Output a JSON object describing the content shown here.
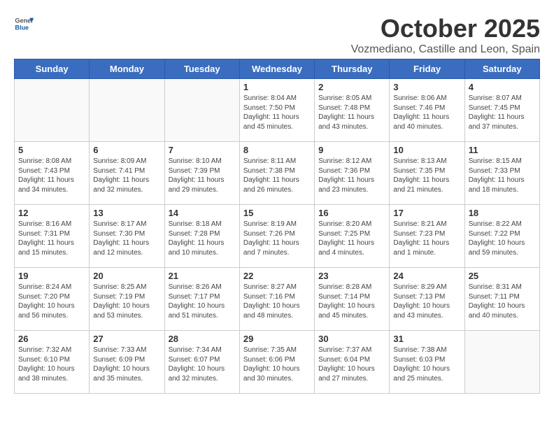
{
  "header": {
    "logo_general": "General",
    "logo_blue": "Blue",
    "month": "October 2025",
    "location": "Vozmediano, Castille and Leon, Spain"
  },
  "weekdays": [
    "Sunday",
    "Monday",
    "Tuesday",
    "Wednesday",
    "Thursday",
    "Friday",
    "Saturday"
  ],
  "weeks": [
    [
      {
        "day": "",
        "info": ""
      },
      {
        "day": "",
        "info": ""
      },
      {
        "day": "",
        "info": ""
      },
      {
        "day": "1",
        "info": "Sunrise: 8:04 AM\nSunset: 7:50 PM\nDaylight: 11 hours\nand 45 minutes."
      },
      {
        "day": "2",
        "info": "Sunrise: 8:05 AM\nSunset: 7:48 PM\nDaylight: 11 hours\nand 43 minutes."
      },
      {
        "day": "3",
        "info": "Sunrise: 8:06 AM\nSunset: 7:46 PM\nDaylight: 11 hours\nand 40 minutes."
      },
      {
        "day": "4",
        "info": "Sunrise: 8:07 AM\nSunset: 7:45 PM\nDaylight: 11 hours\nand 37 minutes."
      }
    ],
    [
      {
        "day": "5",
        "info": "Sunrise: 8:08 AM\nSunset: 7:43 PM\nDaylight: 11 hours\nand 34 minutes."
      },
      {
        "day": "6",
        "info": "Sunrise: 8:09 AM\nSunset: 7:41 PM\nDaylight: 11 hours\nand 32 minutes."
      },
      {
        "day": "7",
        "info": "Sunrise: 8:10 AM\nSunset: 7:39 PM\nDaylight: 11 hours\nand 29 minutes."
      },
      {
        "day": "8",
        "info": "Sunrise: 8:11 AM\nSunset: 7:38 PM\nDaylight: 11 hours\nand 26 minutes."
      },
      {
        "day": "9",
        "info": "Sunrise: 8:12 AM\nSunset: 7:36 PM\nDaylight: 11 hours\nand 23 minutes."
      },
      {
        "day": "10",
        "info": "Sunrise: 8:13 AM\nSunset: 7:35 PM\nDaylight: 11 hours\nand 21 minutes."
      },
      {
        "day": "11",
        "info": "Sunrise: 8:15 AM\nSunset: 7:33 PM\nDaylight: 11 hours\nand 18 minutes."
      }
    ],
    [
      {
        "day": "12",
        "info": "Sunrise: 8:16 AM\nSunset: 7:31 PM\nDaylight: 11 hours\nand 15 minutes."
      },
      {
        "day": "13",
        "info": "Sunrise: 8:17 AM\nSunset: 7:30 PM\nDaylight: 11 hours\nand 12 minutes."
      },
      {
        "day": "14",
        "info": "Sunrise: 8:18 AM\nSunset: 7:28 PM\nDaylight: 11 hours\nand 10 minutes."
      },
      {
        "day": "15",
        "info": "Sunrise: 8:19 AM\nSunset: 7:26 PM\nDaylight: 11 hours\nand 7 minutes."
      },
      {
        "day": "16",
        "info": "Sunrise: 8:20 AM\nSunset: 7:25 PM\nDaylight: 11 hours\nand 4 minutes."
      },
      {
        "day": "17",
        "info": "Sunrise: 8:21 AM\nSunset: 7:23 PM\nDaylight: 11 hours\nand 1 minute."
      },
      {
        "day": "18",
        "info": "Sunrise: 8:22 AM\nSunset: 7:22 PM\nDaylight: 10 hours\nand 59 minutes."
      }
    ],
    [
      {
        "day": "19",
        "info": "Sunrise: 8:24 AM\nSunset: 7:20 PM\nDaylight: 10 hours\nand 56 minutes."
      },
      {
        "day": "20",
        "info": "Sunrise: 8:25 AM\nSunset: 7:19 PM\nDaylight: 10 hours\nand 53 minutes."
      },
      {
        "day": "21",
        "info": "Sunrise: 8:26 AM\nSunset: 7:17 PM\nDaylight: 10 hours\nand 51 minutes."
      },
      {
        "day": "22",
        "info": "Sunrise: 8:27 AM\nSunset: 7:16 PM\nDaylight: 10 hours\nand 48 minutes."
      },
      {
        "day": "23",
        "info": "Sunrise: 8:28 AM\nSunset: 7:14 PM\nDaylight: 10 hours\nand 45 minutes."
      },
      {
        "day": "24",
        "info": "Sunrise: 8:29 AM\nSunset: 7:13 PM\nDaylight: 10 hours\nand 43 minutes."
      },
      {
        "day": "25",
        "info": "Sunrise: 8:31 AM\nSunset: 7:11 PM\nDaylight: 10 hours\nand 40 minutes."
      }
    ],
    [
      {
        "day": "26",
        "info": "Sunrise: 7:32 AM\nSunset: 6:10 PM\nDaylight: 10 hours\nand 38 minutes."
      },
      {
        "day": "27",
        "info": "Sunrise: 7:33 AM\nSunset: 6:09 PM\nDaylight: 10 hours\nand 35 minutes."
      },
      {
        "day": "28",
        "info": "Sunrise: 7:34 AM\nSunset: 6:07 PM\nDaylight: 10 hours\nand 32 minutes."
      },
      {
        "day": "29",
        "info": "Sunrise: 7:35 AM\nSunset: 6:06 PM\nDaylight: 10 hours\nand 30 minutes."
      },
      {
        "day": "30",
        "info": "Sunrise: 7:37 AM\nSunset: 6:04 PM\nDaylight: 10 hours\nand 27 minutes."
      },
      {
        "day": "31",
        "info": "Sunrise: 7:38 AM\nSunset: 6:03 PM\nDaylight: 10 hours\nand 25 minutes."
      },
      {
        "day": "",
        "info": ""
      }
    ]
  ]
}
